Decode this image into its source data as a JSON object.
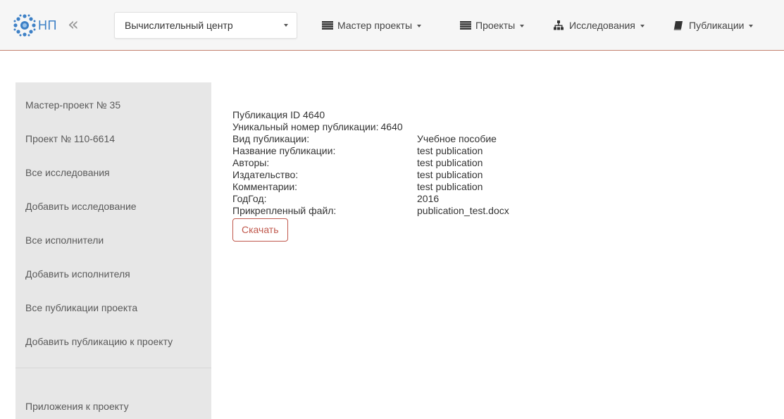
{
  "navbar": {
    "brand": "НП",
    "collapse_glyph": "«",
    "org_select": {
      "value": "Вычислительный центр"
    },
    "menus": [
      {
        "label": "Мастер проекты",
        "icon": "list-icon"
      },
      {
        "label": "Проекты",
        "icon": "list-icon"
      },
      {
        "label": "Исследования",
        "icon": "sitemap-icon"
      },
      {
        "label": "Публикации",
        "icon": "book-icon"
      }
    ]
  },
  "sidebar": {
    "items": [
      {
        "label": "Мастер-проект № 35"
      },
      {
        "label": "Проект № 110-6614"
      },
      {
        "label": "Все исследования"
      },
      {
        "label": "Добавить исследование"
      },
      {
        "label": "Все исполнители"
      },
      {
        "label": "Добавить исполнителя"
      },
      {
        "label": "Все публикации проекта"
      },
      {
        "label": "Добавить публикацию к проекту"
      }
    ],
    "bottom_items": [
      {
        "label": "Приложения к проекту"
      }
    ]
  },
  "publication": {
    "title": "Публикация ID 4640",
    "fields": [
      {
        "label": "Уникальный номер публикации:",
        "value": "4640"
      },
      {
        "label": "Вид публикации:",
        "value": "Учебное пособие"
      },
      {
        "label": "Название публикации:",
        "value": "test publication"
      },
      {
        "label": "Авторы:",
        "value": "test publication"
      },
      {
        "label": "Издательство:",
        "value": "test publication"
      },
      {
        "label": "Комментарии:",
        "value": "test publication"
      },
      {
        "label": "ГодГод:",
        "value": "2016"
      },
      {
        "label": "Прикрепленный файл:",
        "value": "publication_test.docx"
      }
    ],
    "download_label": "Скачать"
  },
  "colors": {
    "brand": "#3d80c6",
    "accent_border": "#c4826e",
    "button_accent": "#c0584c",
    "sidebar_bg": "#e7e7e7",
    "navbar_bg": "#f6f6f6"
  }
}
